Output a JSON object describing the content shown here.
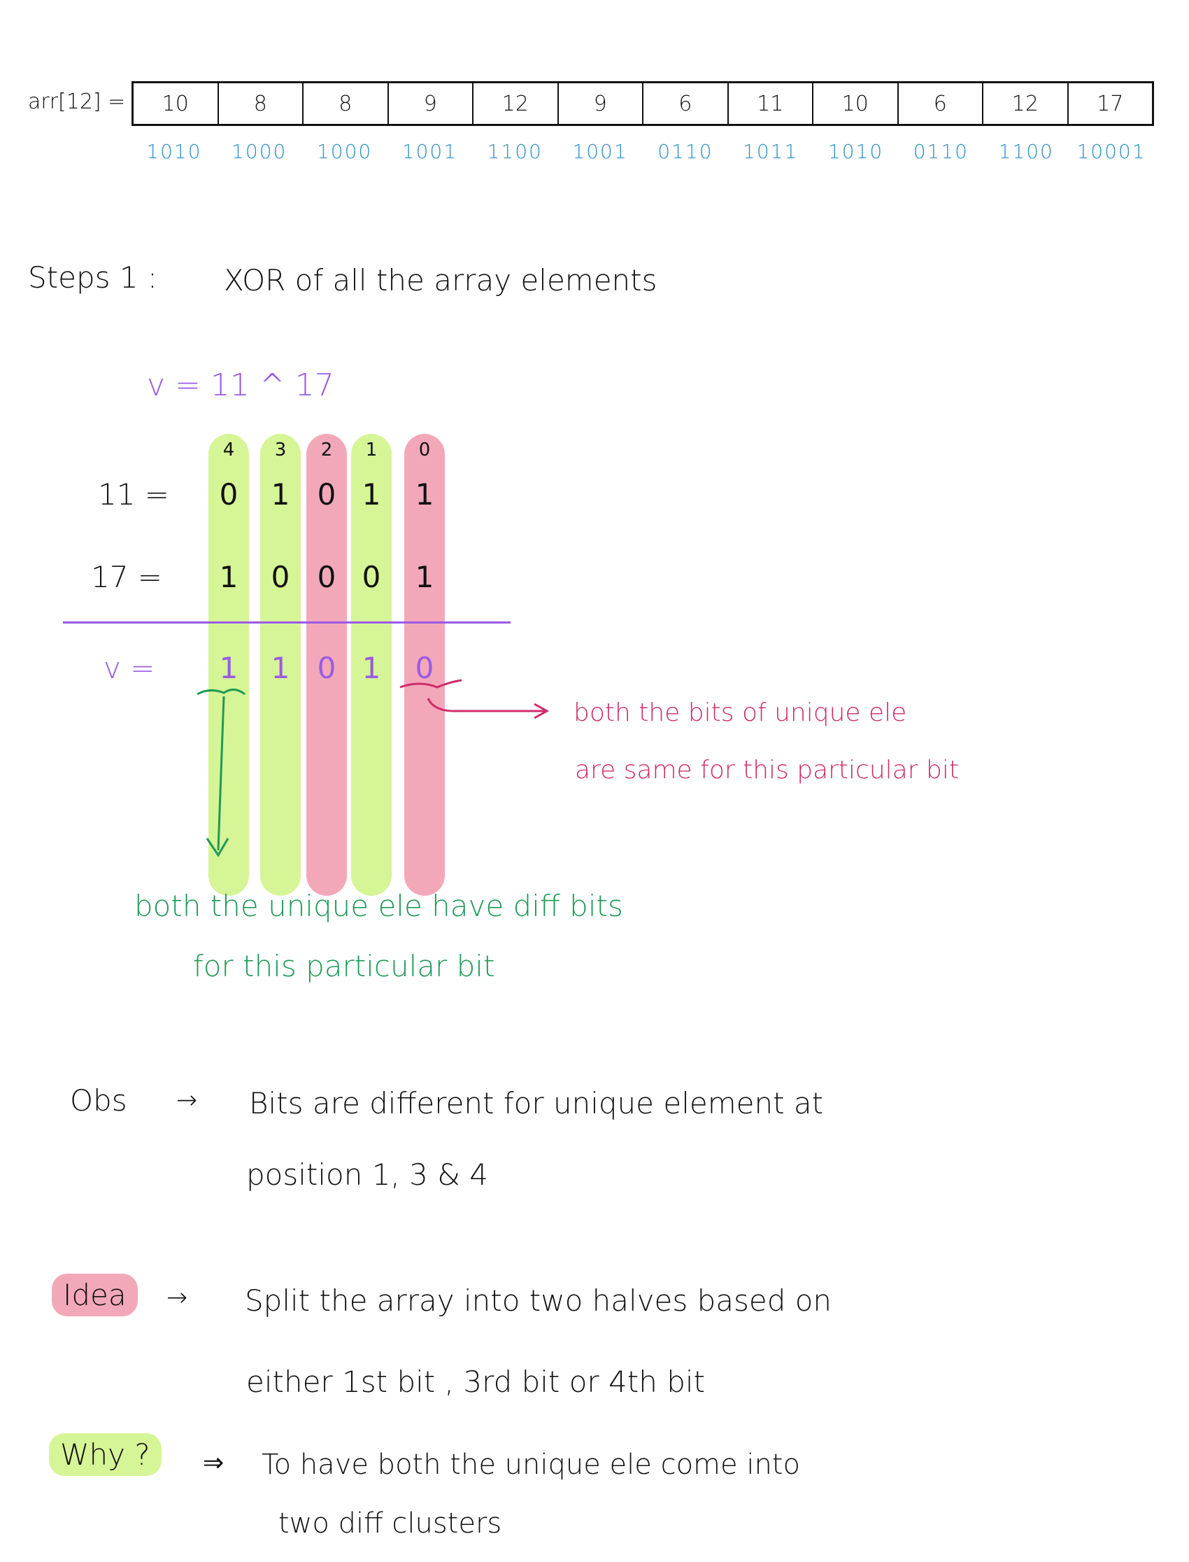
{
  "array": {
    "label": "arr[12] =",
    "values": [
      "10",
      "8",
      "8",
      "9",
      "12",
      "9",
      "6",
      "11",
      "10",
      "6",
      "12",
      "17"
    ],
    "binary": [
      "1010",
      "1000",
      "1000",
      "1001",
      "1100",
      "1001",
      "0110",
      "1011",
      "1010",
      "0110",
      "1100",
      "10001"
    ]
  },
  "step1": {
    "label": "Steps 1 :",
    "text": "XOR  of  all  the  array  elements"
  },
  "xor": {
    "v_expr": "v = 11 ^ 17",
    "bit_indices": [
      "4",
      "3",
      "2",
      "1",
      "0"
    ],
    "row11_label": "11 =",
    "row11_bits": [
      "0",
      "1",
      "0",
      "1",
      "1"
    ],
    "row17_label": "17 =",
    "row17_bits": [
      "1",
      "0",
      "0",
      "0",
      "1"
    ],
    "rowv_label": "v =",
    "rowv_bits": [
      "1",
      "1",
      "0",
      "1",
      "0"
    ]
  },
  "notes": {
    "pink_line1": "both   the   bits   of   unique   ele",
    "pink_line2": "are    same    for  this    particular bit",
    "green_line1": "both    the    unique    ele      have    diff   bits",
    "green_line2": "for    this    particular   bit"
  },
  "obs": {
    "label": "Obs",
    "arrow": "→",
    "line1": "Bits    are    different   for  unique    element  at",
    "line2": "position   1, 3 & 4"
  },
  "idea": {
    "label": "Idea",
    "arrow": "→",
    "line1": "Split   the   array   into   two    halves     based   on",
    "line2": "either          1st bit ,  3rd bit   or    4th bit"
  },
  "why": {
    "label": "Why ?",
    "arrow": "⇒",
    "line1": "To     have     both    the     unique     ele      come into",
    "line2": "two    diff  clusters"
  },
  "colors": {
    "lime": "#d6f596",
    "rose": "#f3a8b9",
    "blue": "#2a8fd0",
    "purple": "#9a5ae6",
    "green": "#1f9a55",
    "pink": "#d12b6a"
  }
}
